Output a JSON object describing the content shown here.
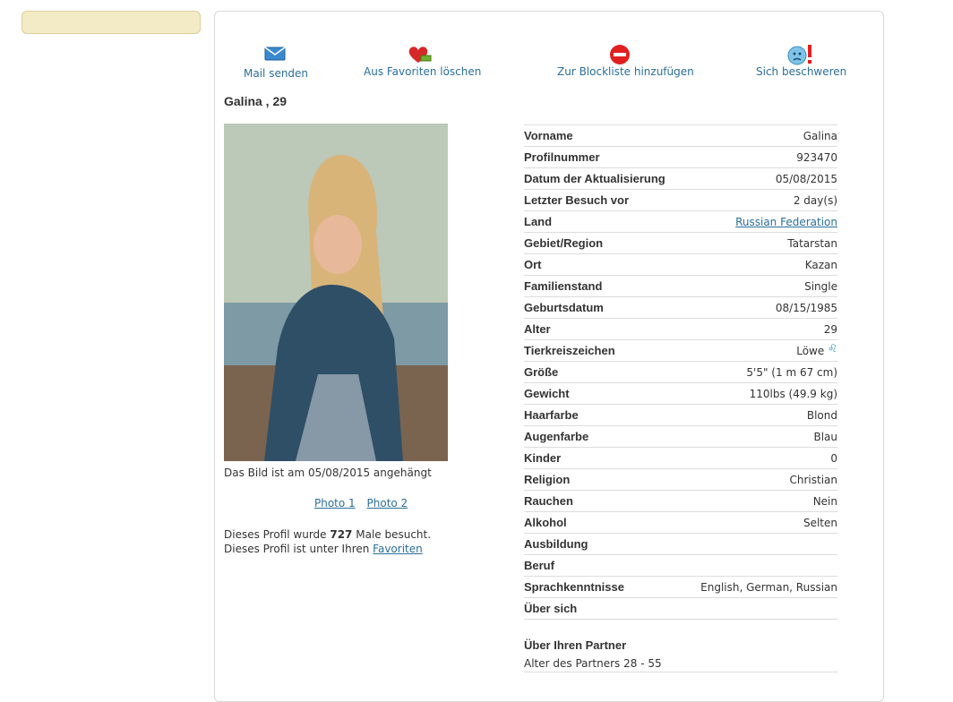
{
  "actions": {
    "mail": "Mail senden",
    "remove_favorite": "Aus Favoriten löschen",
    "block": "Zur Blockliste hinzufügen",
    "complain": "Sich beschweren"
  },
  "profile": {
    "title": "Galina , 29"
  },
  "photo": {
    "caption": "Das Bild ist am 05/08/2015 angehängt",
    "links": [
      "Photo 1",
      "Photo 2"
    ]
  },
  "visits": {
    "prefix": "Dieses Profil wurde ",
    "count": "727",
    "suffix": " Male besucht.",
    "favorites_text": "Dieses Profil ist unter Ihren ",
    "favorites_link": "Favoriten"
  },
  "details": [
    {
      "label": "Vorname",
      "value": "Galina"
    },
    {
      "label": "Profilnummer",
      "value": "923470"
    },
    {
      "label": "Datum der Aktualisierung",
      "value": "05/08/2015"
    },
    {
      "label": "Letzter Besuch vor",
      "value": "2 day(s)"
    },
    {
      "label": "Land",
      "value": "Russian Federation"
    },
    {
      "label": "Gebiet/Region",
      "value": "Tatarstan"
    },
    {
      "label": "Ort",
      "value": "Kazan"
    },
    {
      "label": "Familienstand",
      "value": "Single"
    },
    {
      "label": "Geburtsdatum",
      "value": "08/15/1985"
    },
    {
      "label": "Alter",
      "value": "29"
    },
    {
      "label": "Tierkreiszeichen",
      "value": "Löwe"
    },
    {
      "label": "Größe",
      "value": "5'5\" (1 m 67 cm)"
    },
    {
      "label": "Gewicht",
      "value": "110lbs (49.9 kg)"
    },
    {
      "label": "Haarfarbe",
      "value": "Blond"
    },
    {
      "label": "Augenfarbe",
      "value": "Blau"
    },
    {
      "label": "Kinder",
      "value": "0"
    },
    {
      "label": "Religion",
      "value": "Christian"
    },
    {
      "label": "Rauchen",
      "value": "Nein"
    },
    {
      "label": "Alkohol",
      "value": "Selten"
    },
    {
      "label": "Ausbildung",
      "value": ""
    },
    {
      "label": "Beruf",
      "value": ""
    },
    {
      "label": "Sprachkenntnisse",
      "value": "English, German, Russian"
    },
    {
      "label": "Über sich",
      "value": ""
    }
  ],
  "zodiac_glyph": "♌",
  "partner": {
    "heading": "Über Ihren Partner",
    "age_range": "Alter des Partners 28 - 55"
  },
  "colors": {
    "link": "#2a6f9b",
    "sidebar": "#f2ebc5"
  }
}
